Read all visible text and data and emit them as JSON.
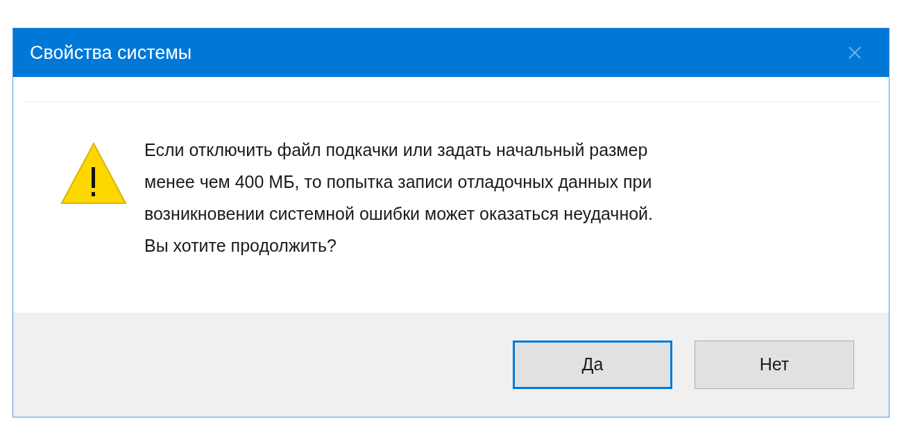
{
  "window": {
    "title": "Свойства системы"
  },
  "message_lines": [
    "Если отключить файл подкачки или задать начальный размер",
    "менее чем 400 МБ, то попытка записи отладочных данных при",
    "возникновении системной ошибки может оказаться неудачной.",
    "Вы хотите продолжить?"
  ],
  "buttons": [
    {
      "label": "Да",
      "default": true
    },
    {
      "label": "Нет",
      "default": false
    }
  ]
}
